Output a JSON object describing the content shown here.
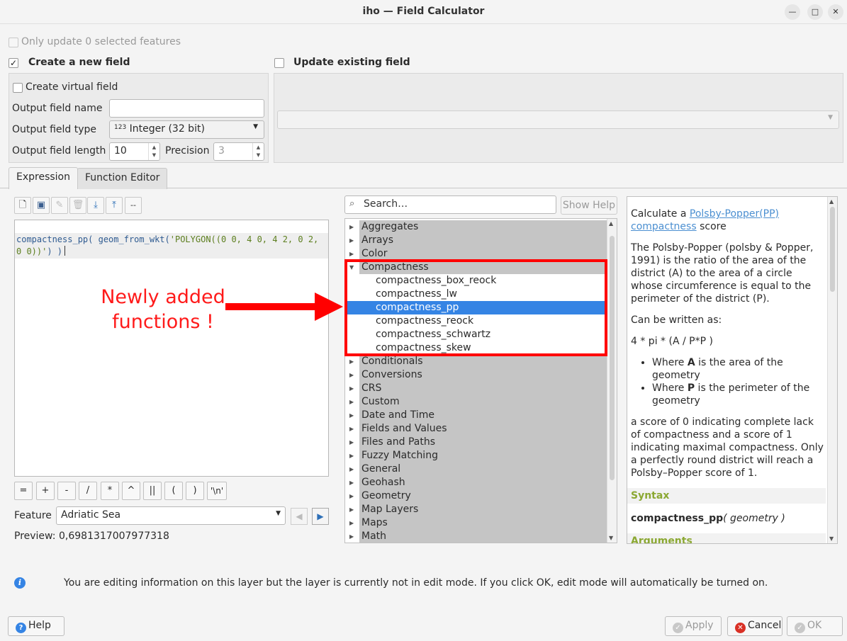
{
  "window": {
    "title": "iho — Field Calculator"
  },
  "options": {
    "only_update": "Only update 0 selected features",
    "create_new": "Create a new field",
    "update_existing": "Update existing field",
    "create_virtual": "Create virtual field"
  },
  "fields": {
    "output_name_label": "Output field name",
    "output_name_value": "",
    "output_type_label": "Output field type",
    "output_type_icon": "123",
    "output_type_value": "Integer (32 bit)",
    "output_length_label": "Output field length",
    "output_length_value": "10",
    "precision_label": "Precision",
    "precision_value": "3"
  },
  "tabs": [
    "Expression",
    "Function Editor"
  ],
  "editor": {
    "code_func": "compactness_pp( geom_from_wkt(",
    "code_str": "'POLYGON((0 0, 4 0, 4 2, 0 2, 0 0))'",
    "code_end": ") )"
  },
  "operators": [
    "=",
    "+",
    "-",
    "/",
    "*",
    "^",
    "||",
    "(",
    ")",
    "'\\n'"
  ],
  "feature": {
    "label": "Feature",
    "value": "Adriatic Sea"
  },
  "preview": {
    "label": "Preview:",
    "value": "0,6981317007977318"
  },
  "search": {
    "placeholder": "Search…",
    "show_help": "Show Help"
  },
  "tree": {
    "groups_before": [
      "Aggregates",
      "Arrays",
      "Color"
    ],
    "expanded_group": "Compactness",
    "children": [
      "compactness_box_reock",
      "compactness_lw",
      "compactness_pp",
      "compactness_reock",
      "compactness_schwartz",
      "compactness_skew"
    ],
    "selected_child": "compactness_pp",
    "groups_after": [
      "Conditionals",
      "Conversions",
      "CRS",
      "Custom",
      "Date and Time",
      "Fields and Values",
      "Files and Paths",
      "Fuzzy Matching",
      "General",
      "Geohash",
      "Geometry",
      "Map Layers",
      "Maps",
      "Math"
    ]
  },
  "annotation": {
    "line1": "Newly added",
    "line2": "functions !"
  },
  "help": {
    "intro_pre": "Calculate a ",
    "intro_link": "Polsby-Popper(PP) compactness",
    "intro_post": " score",
    "para1": "The Polsby-Popper (polsby & Popper, 1991) is the ratio of the area of the district (A) to the area of a circle whose circumference is equal to the perimeter of the district (P).",
    "para2": "Can be written as:",
    "formula": "4 * pi * (A / P*P )",
    "bullet1_pre": "Where ",
    "bullet1_key": "A",
    "bullet1_post": " is the area of the geometry",
    "bullet2_pre": "Where ",
    "bullet2_key": "P",
    "bullet2_post": " is the perimeter of the geometry",
    "para3": "a score of 0 indicating complete lack of compactness and a score of 1 indicating maximal compactness. Only a perfectly round district will reach a Polsby–Popper score of 1.",
    "syntax_heading": "Syntax",
    "syntax_func": "compactness_pp",
    "syntax_args": "( geometry )",
    "arguments_heading": "Arguments"
  },
  "info_message": "You are editing information on this layer but the layer is currently not in edit mode. If you click OK, edit mode will automatically be turned on.",
  "buttons": {
    "help": "Help",
    "apply": "Apply",
    "cancel": "Cancel",
    "ok": "OK"
  },
  "colors": {
    "accent": "#3584e4",
    "annotation": "#ff0000",
    "syntax": "#8ba832"
  }
}
